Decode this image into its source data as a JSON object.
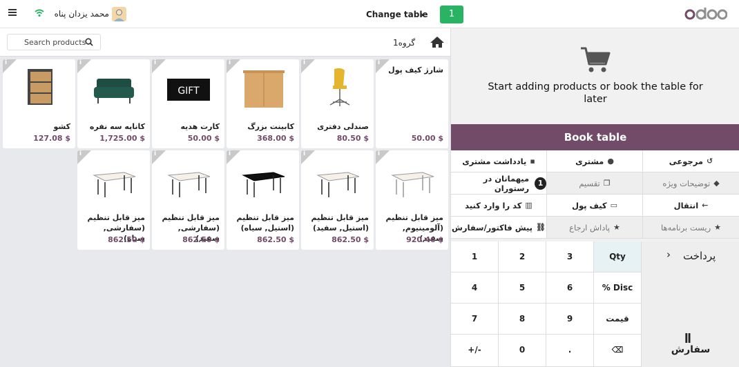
{
  "header": {
    "user_name": "محمد یزدان پناه",
    "change_table": "Change table",
    "table_number": "1",
    "logo_o": "odoo"
  },
  "products_bar": {
    "search_placeholder": "Search products",
    "group_label": "گروه1"
  },
  "products": [
    {
      "name": "شارژ کیف پول",
      "price": "50.00 $"
    },
    {
      "name": "صندلی دفتری",
      "price": "80.50 $"
    },
    {
      "name": "کابینت بزرگ",
      "price": "368.00 $"
    },
    {
      "name": "کارت هدیه",
      "price": "50.00 $",
      "img_text": "GIFT"
    },
    {
      "name": "کاناپه سه نفره",
      "price": "1,725.00 $"
    },
    {
      "name": "کشو",
      "price": "127.08 $"
    },
    {
      "name": "میز قابل تنظیم (آلومینیوم, سفید)",
      "price": "920.46 $"
    },
    {
      "name": "میز قابل تنظیم (استیل, سفید)",
      "price": "862.50 $"
    },
    {
      "name": "میز قابل تنظیم (استیل, سیاه)",
      "price": "862.50 $"
    },
    {
      "name": "میز قابل تنظیم (سفارشی, سفید)",
      "price": "862.50 $"
    },
    {
      "name": "میز قابل تنظیم (سفارشی, سیاه)",
      "price": "862.50 $"
    }
  ],
  "order": {
    "empty_text": "Start adding products or book the table for later",
    "book_table": "Book table"
  },
  "controls": {
    "refund": "مرجوعی",
    "customer": "مشتری",
    "customer_note": "یادداشت مشتری",
    "internal_note": "توضیحات ویژه",
    "split": "تقسیم",
    "guests_count": "1",
    "guests": "میهمانان در رستوران",
    "transfer": "انتقال",
    "ewallet": "کیف پول",
    "enter_code": "کد را وارد کنید",
    "reset_programs": "ریست برنامه‌ها",
    "reward": "پاداش ارجاع",
    "quotation": "پیش فاکتور/سفارش"
  },
  "numpad": {
    "k1": "1",
    "k2": "2",
    "k3": "3",
    "qty": "Qty",
    "k4": "4",
    "k5": "5",
    "k6": "6",
    "disc": "% Disc",
    "k7": "7",
    "k8": "8",
    "k9": "9",
    "price": "قیمت",
    "plusminus": "+/-",
    "k0": "0",
    "dot": ".",
    "backspace": "⌫"
  },
  "actions": {
    "payment": "پرداخت",
    "order": "سفارش"
  },
  "colors": {
    "brand": "#714b67",
    "table_badge": "#28b463"
  }
}
